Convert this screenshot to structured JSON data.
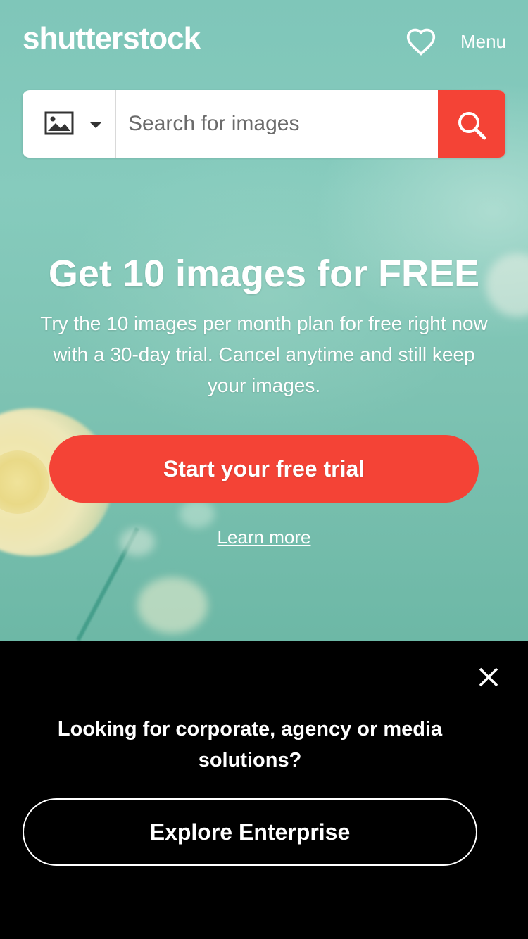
{
  "header": {
    "logo": "shutterstock",
    "menu_label": "Menu",
    "heart_icon": "heart-outline-icon"
  },
  "search": {
    "type_icon": "image-icon",
    "placeholder": "Search for images",
    "button_icon": "search-icon"
  },
  "hero": {
    "headline": "Get 10 images for FREE",
    "subtext": "Try the 10 images per month plan for free right now with a 30-day trial. Cancel anytime and still keep your images.",
    "cta_label": "Start your free trial",
    "learn_more": "Learn more"
  },
  "banner": {
    "text": "Looking for corporate, agency or media solutions?",
    "button_label": "Explore Enterprise",
    "close_icon": "close-icon"
  },
  "colors": {
    "accent": "#f44336",
    "banner_bg": "#000000"
  }
}
